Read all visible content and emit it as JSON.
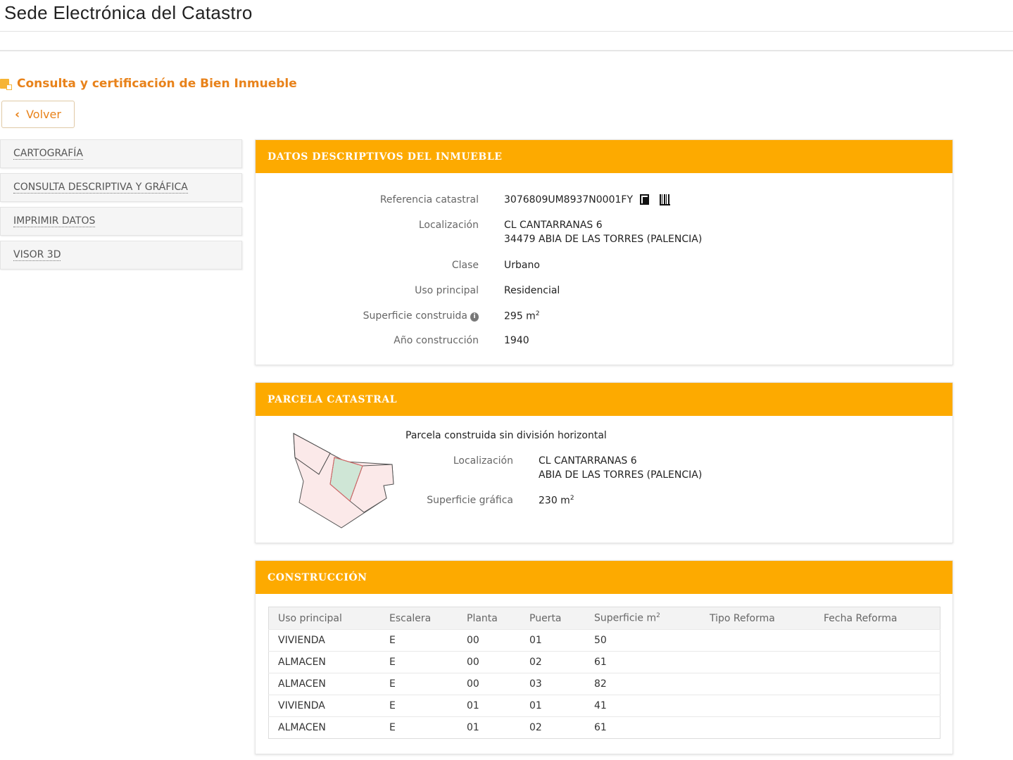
{
  "header": {
    "title": "Sede Electrónica del Catastro"
  },
  "page": {
    "heading": "Consulta y certificación de Bien Inmueble",
    "back_label": "Volver"
  },
  "sidebar": {
    "items": [
      {
        "label": "CARTOGRAFÍA"
      },
      {
        "label": "CONSULTA DESCRIPTIVA Y GRÁFICA"
      },
      {
        "label": "IMPRIMIR DATOS"
      },
      {
        "label": "VISOR 3D"
      }
    ]
  },
  "datos": {
    "title": "DATOS DESCRIPTIVOS DEL INMUEBLE",
    "ref_label": "Referencia catastral",
    "ref_value": "3076809UM8937N0001FY",
    "loc_label": "Localización",
    "loc_line1": "CL CANTARRANAS 6",
    "loc_line2": "34479 ABIA DE LAS TORRES (PALENCIA)",
    "clase_label": "Clase",
    "clase_value": "Urbano",
    "uso_label": "Uso principal",
    "uso_value": "Residencial",
    "sup_label": "Superficie construida",
    "sup_value": "295 m",
    "sup_unit_exp": "2",
    "anio_label": "Año construcción",
    "anio_value": "1940"
  },
  "parcela": {
    "title": "PARCELA CATASTRAL",
    "subtitle": "Parcela construida sin división horizontal",
    "loc_label": "Localización",
    "loc_line1": "CL CANTARRANAS 6",
    "loc_line2": "ABIA DE LAS TORRES (PALENCIA)",
    "sup_label": "Superficie gráfica",
    "sup_value": "230 m",
    "sup_unit_exp": "2"
  },
  "construccion": {
    "title": "CONSTRUCCIÓN",
    "columns": [
      "Uso principal",
      "Escalera",
      "Planta",
      "Puerta",
      "Superficie m",
      "Tipo Reforma",
      "Fecha Reforma"
    ],
    "sup_col_exp": "2",
    "rows": [
      [
        "VIVIENDA",
        "E",
        "00",
        "01",
        "50",
        "",
        ""
      ],
      [
        "ALMACEN",
        "E",
        "00",
        "02",
        "61",
        "",
        ""
      ],
      [
        "ALMACEN",
        "E",
        "00",
        "03",
        "82",
        "",
        ""
      ],
      [
        "VIVIENDA",
        "E",
        "01",
        "01",
        "41",
        "",
        ""
      ],
      [
        "ALMACEN",
        "E",
        "01",
        "02",
        "61",
        "",
        ""
      ]
    ]
  },
  "colors": {
    "accent": "#fdaa00",
    "heading": "#e8821a"
  }
}
